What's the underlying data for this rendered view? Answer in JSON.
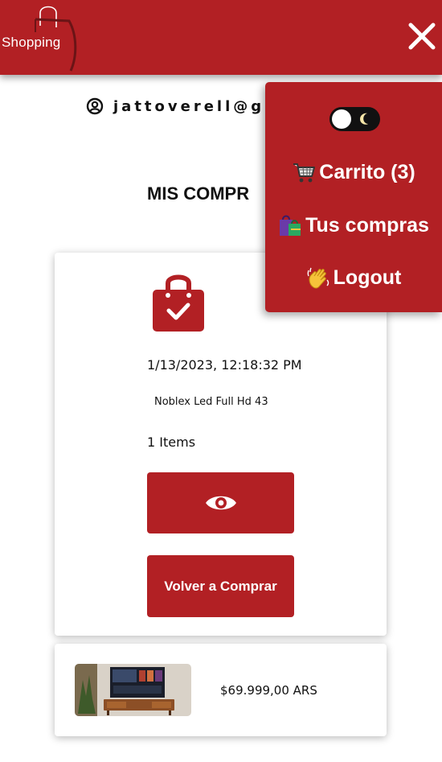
{
  "header": {
    "logo_text": "Shopping",
    "brand_color": "#b22024"
  },
  "user": {
    "email": "jattoverell@gm"
  },
  "page": {
    "title": "MIS COMPR"
  },
  "order": {
    "icon": "shopping-bag-check-icon",
    "date": "1/13/2023, 12:18:32 PM",
    "product": "Noblex Led Full Hd 43",
    "count": "1 Items",
    "view_icon": "eye-icon",
    "rebuy_label": "Volver a Comprar"
  },
  "product_item": {
    "price": "$69.999,00 ARS"
  },
  "menu": {
    "theme_toggle": "dark-mode-toggle",
    "cart_label": "Carrito (3)",
    "orders_label": "Tus compras",
    "logout_label": "Logout"
  }
}
